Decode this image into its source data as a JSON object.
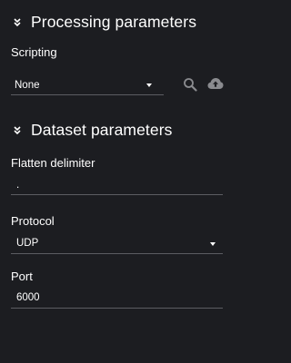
{
  "processing": {
    "title": "Processing parameters",
    "scripting_label": "Scripting",
    "scripting_value": "None"
  },
  "dataset": {
    "title": "Dataset parameters",
    "flatten_label": "Flatten delimiter",
    "flatten_value": ".",
    "protocol_label": "Protocol",
    "protocol_value": "UDP",
    "port_label": "Port",
    "port_value": "6000"
  },
  "icons": [
    "chevron-collapse-icon",
    "search-icon",
    "cloud-upload-icon",
    "dropdown-caret-icon"
  ],
  "colors": {
    "background": "#1c1d21",
    "text": "#ffffff",
    "underline": "#5c5d62",
    "icon": "#8a8b8f"
  }
}
